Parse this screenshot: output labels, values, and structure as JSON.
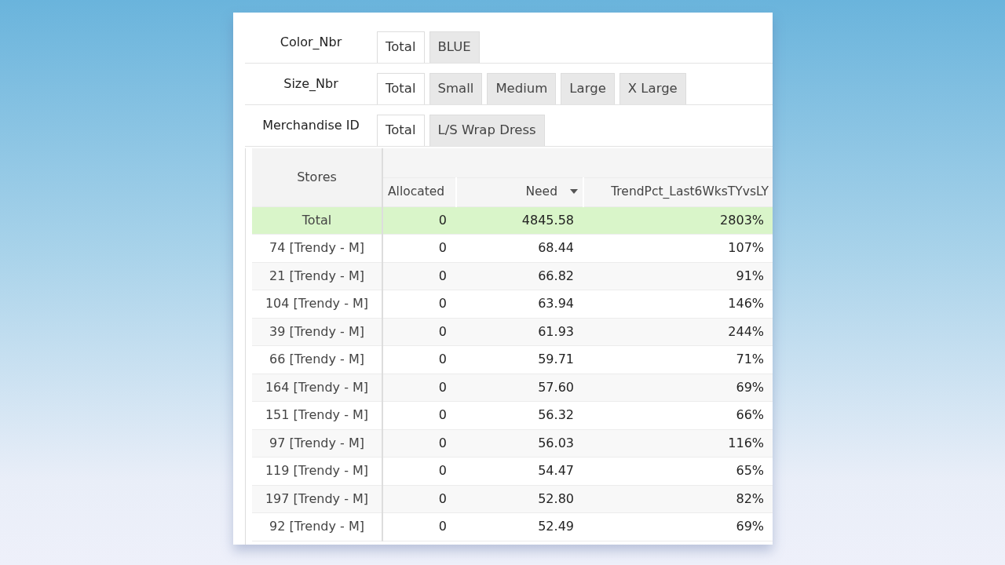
{
  "filters": [
    {
      "label": "Color_Nbr",
      "tabs": [
        {
          "label": "Total",
          "selected": true
        },
        {
          "label": "BLUE",
          "selected": false
        }
      ]
    },
    {
      "label": "Size_Nbr",
      "tabs": [
        {
          "label": "Total",
          "selected": true
        },
        {
          "label": "Small",
          "selected": false
        },
        {
          "label": "Medium",
          "selected": false
        },
        {
          "label": "Large",
          "selected": false
        },
        {
          "label": "X Large",
          "selected": false
        }
      ]
    },
    {
      "label": "Merchandise ID",
      "tabs": [
        {
          "label": "Total",
          "selected": true
        },
        {
          "label": "L/S Wrap Dress",
          "selected": false
        }
      ]
    }
  ],
  "table": {
    "row_header": "Stores",
    "columns": [
      {
        "label": "Allocated"
      },
      {
        "label": "Need",
        "sorted": true
      },
      {
        "label": "TrendPct_Last6WksTYvsLY"
      }
    ],
    "total": {
      "label": "Total",
      "cells": [
        "0",
        "4845.58",
        "2803%"
      ]
    },
    "rows": [
      {
        "label": "74 [Trendy - M]",
        "cells": [
          "0",
          "68.44",
          "107%"
        ]
      },
      {
        "label": "21 [Trendy - M]",
        "cells": [
          "0",
          "66.82",
          "91%"
        ]
      },
      {
        "label": "104 [Trendy - M]",
        "cells": [
          "0",
          "63.94",
          "146%"
        ]
      },
      {
        "label": "39 [Trendy - M]",
        "cells": [
          "0",
          "61.93",
          "244%"
        ]
      },
      {
        "label": "66 [Trendy - M]",
        "cells": [
          "0",
          "59.71",
          "71%"
        ]
      },
      {
        "label": "164 [Trendy - M]",
        "cells": [
          "0",
          "57.60",
          "69%"
        ]
      },
      {
        "label": "151 [Trendy - M]",
        "cells": [
          "0",
          "56.32",
          "66%"
        ]
      },
      {
        "label": "97 [Trendy - M]",
        "cells": [
          "0",
          "56.03",
          "116%"
        ]
      },
      {
        "label": "119 [Trendy - M]",
        "cells": [
          "0",
          "54.47",
          "65%"
        ]
      },
      {
        "label": "197 [Trendy - M]",
        "cells": [
          "0",
          "52.80",
          "82%"
        ]
      },
      {
        "label": "92 [Trendy - M]",
        "cells": [
          "0",
          "52.49",
          "69%"
        ]
      }
    ]
  }
}
